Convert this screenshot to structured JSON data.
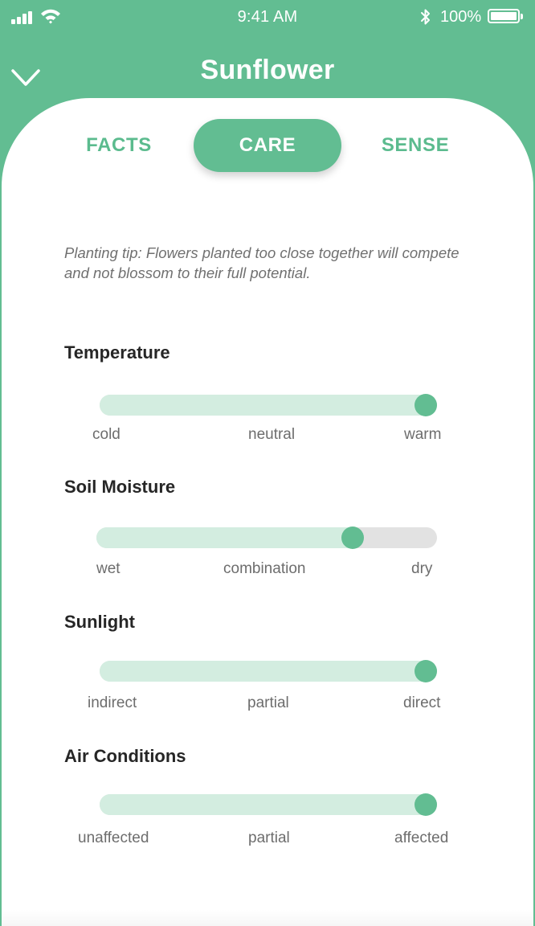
{
  "status_bar": {
    "time": "9:41 AM",
    "battery": "100%",
    "icons": [
      "signal-icon",
      "wifi-icon",
      "bluetooth-icon",
      "battery-icon"
    ]
  },
  "header": {
    "title": "Sunflower",
    "back_icon": "chevron-down-icon"
  },
  "tabs": [
    {
      "label": "FACTS",
      "active": false
    },
    {
      "label": "CARE",
      "active": true
    },
    {
      "label": "SENSE",
      "active": false
    }
  ],
  "tip": "Planting tip: Flowers planted too close together will compete and not blossom to their full potential.",
  "sliders": [
    {
      "label": "Temperature",
      "value": 1.0,
      "ticks": [
        "cold",
        "neutral",
        "warm"
      ]
    },
    {
      "label": "Soil Moisture",
      "value": 0.77,
      "ticks": [
        "wet",
        "combination",
        "dry"
      ]
    },
    {
      "label": "Sunlight",
      "value": 1.0,
      "ticks": [
        "indirect",
        "partial",
        "direct"
      ]
    },
    {
      "label": "Air Conditions",
      "value": 1.0,
      "ticks": [
        "unaffected",
        "partial",
        "affected"
      ]
    }
  ],
  "colors": {
    "accent": "#62bd92",
    "track_fill": "#d3ede0",
    "track_empty": "#e2e2e2",
    "text_dark": "#262626",
    "text_muted": "#6d6d6d"
  }
}
